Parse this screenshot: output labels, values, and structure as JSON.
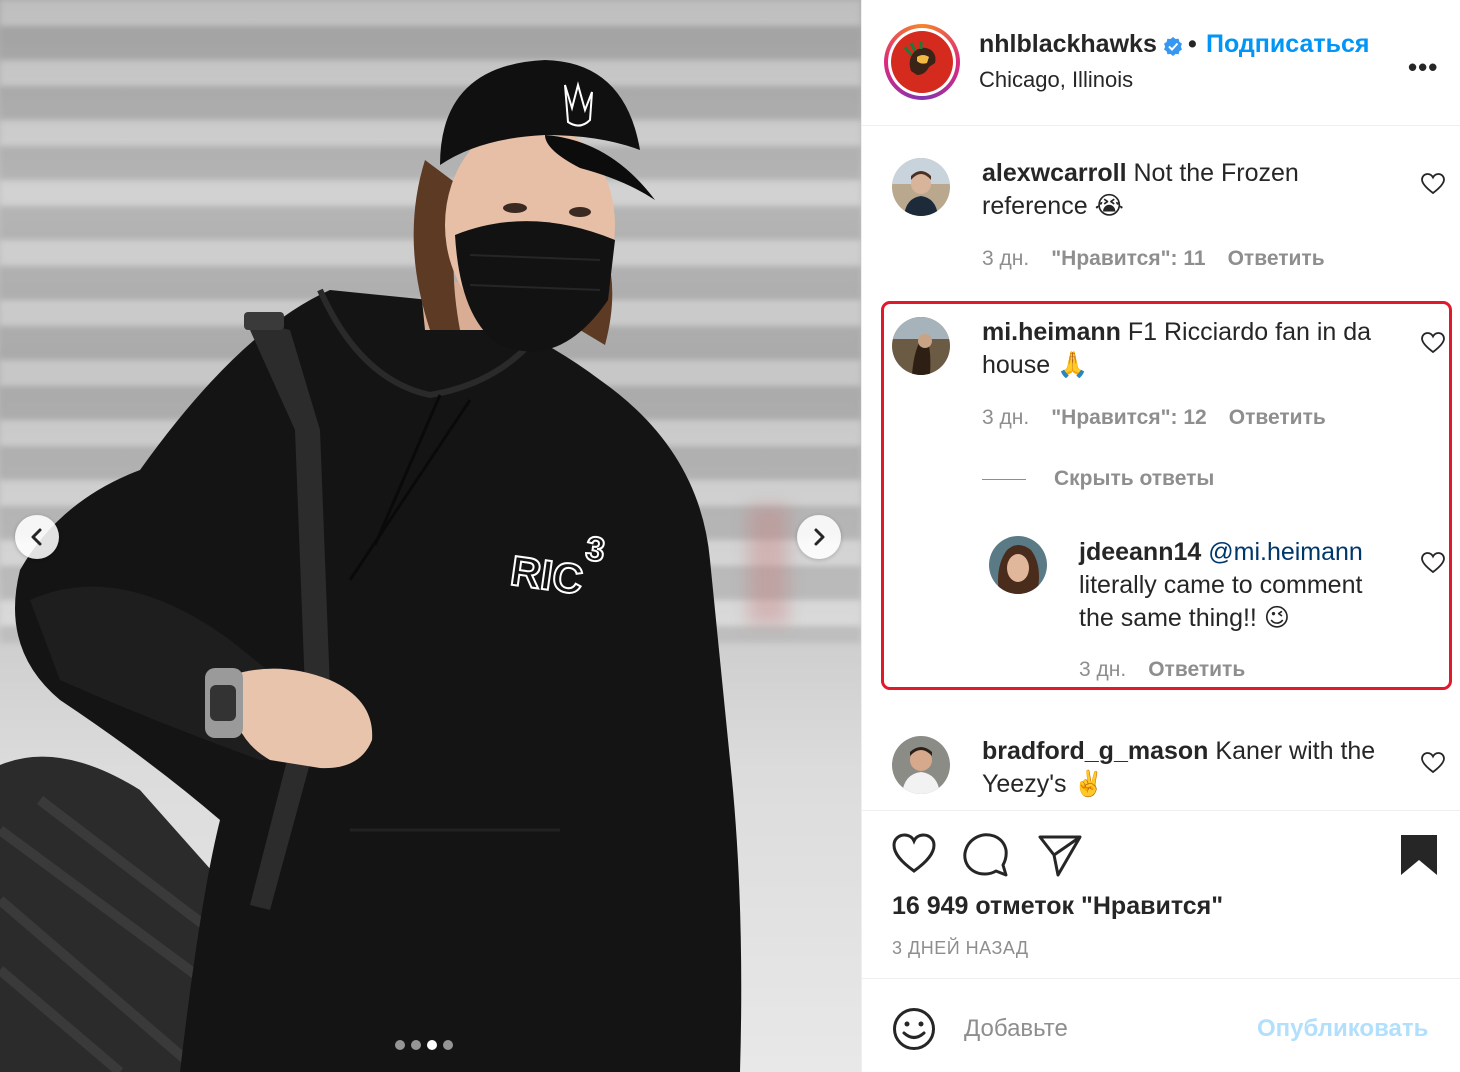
{
  "post": {
    "username": "nhlblackhawks",
    "follow_label": "Подписаться",
    "separator": "•",
    "location": "Chicago, Illinois",
    "more_label": "•••",
    "verified": true
  },
  "photo": {
    "carousel_count": 4,
    "carousel_active_index": 2,
    "hoodie_print": "RIC",
    "hoodie_number": "3"
  },
  "comments": [
    {
      "username": "alexwcarroll",
      "text": "Not the Frozen reference",
      "emoji": "😭",
      "time": "3 дн.",
      "likes": "\"Нравится\": 11",
      "reply_label": "Ответить"
    },
    {
      "username": "mi.heimann",
      "text": "F1 Ricciardo fan in da house",
      "emoji": "🙏",
      "time": "3 дн.",
      "likes": "\"Нравится\": 12",
      "reply_label": "Ответить",
      "hide_replies_label": "Скрыть ответы",
      "replies": [
        {
          "username": "jdeeann14",
          "mention": "@mi.heimann",
          "text": "literally came to comment the same thing!!",
          "emoji": "😉",
          "time": "3 дн.",
          "reply_label": "Ответить"
        }
      ]
    },
    {
      "username": "bradford_g_mason",
      "text": "Kaner with the Yeezy's",
      "emoji": "✌️",
      "time": "",
      "likes": ""
    }
  ],
  "stats": {
    "likes_label": "16 949 отметок \"Нравится\"",
    "date_label": "3 ДНЕЙ НАЗАД"
  },
  "composer": {
    "placeholder": "Добавьте",
    "publish_label": "Опубликовать"
  },
  "colors": {
    "link_blue": "#0095f6",
    "highlight_red": "#e0192b",
    "muted": "#8e8e8e",
    "publish_disabled": "#b2dffc"
  },
  "icons": [
    "chevron-left-icon",
    "chevron-right-icon",
    "verified-badge-icon",
    "heart-icon",
    "comment-icon",
    "share-icon",
    "bookmark-icon",
    "smile-icon"
  ]
}
